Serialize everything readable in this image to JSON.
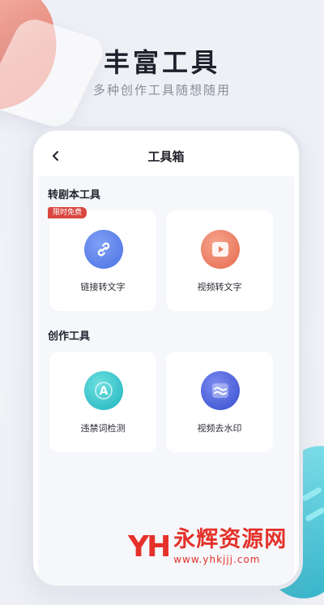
{
  "hero": {
    "title": "丰富工具",
    "subtitle": "多种创作工具随想随用"
  },
  "nav": {
    "title": "工具箱",
    "back_icon": "chevron-left-icon"
  },
  "sections": [
    {
      "title": "转剧本工具",
      "cards": [
        {
          "label": "链接转文字",
          "badge": "限时免费",
          "icon": "link-icon",
          "color": "#5a7fe8"
        },
        {
          "label": "视频转文字",
          "icon": "video-play-icon",
          "color": "#ea7a60"
        }
      ]
    },
    {
      "title": "创作工具",
      "cards": [
        {
          "label": "违禁词检测",
          "icon": "letter-a-icon",
          "color": "#35c0c8"
        },
        {
          "label": "视频去水印",
          "icon": "wave-image-icon",
          "color": "#4a5fd8"
        }
      ]
    }
  ],
  "watermark": {
    "logo": "YH",
    "name": "永辉资源网",
    "url": "www.yhkjjj.com"
  }
}
